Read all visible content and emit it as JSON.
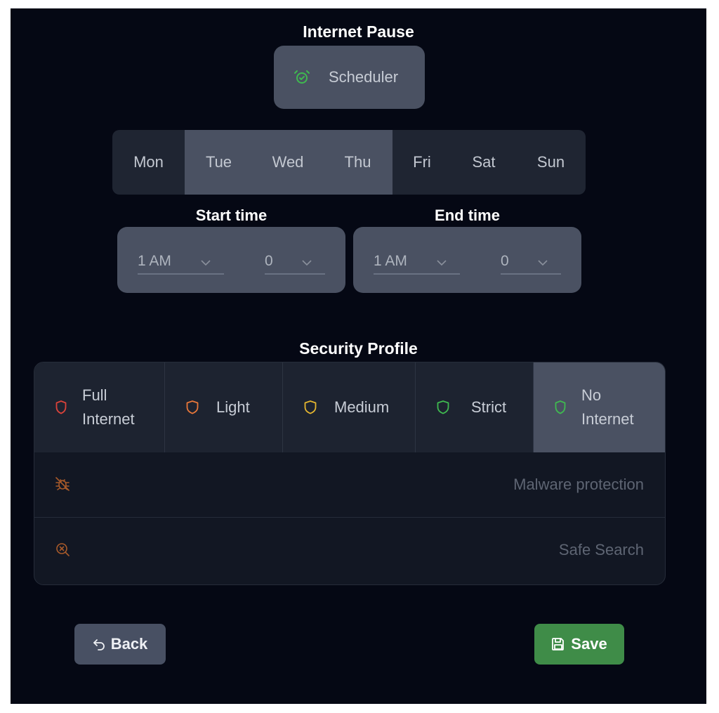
{
  "title": "Internet Pause",
  "scheduler": {
    "label": "Scheduler",
    "icon": "alarm-clock-icon",
    "icon_color": "#3fb950"
  },
  "days": [
    {
      "label": "Mon",
      "selected": false
    },
    {
      "label": "Tue",
      "selected": true
    },
    {
      "label": "Wed",
      "selected": true
    },
    {
      "label": "Thu",
      "selected": true
    },
    {
      "label": "Fri",
      "selected": false
    },
    {
      "label": "Sat",
      "selected": false
    },
    {
      "label": "Sun",
      "selected": false
    }
  ],
  "start_time": {
    "label": "Start time",
    "hour": "1 AM",
    "minute": "0"
  },
  "end_time": {
    "label": "End time",
    "hour": "1 AM",
    "minute": "0"
  },
  "security_profile": {
    "title": "Security Profile",
    "options": [
      {
        "line1": "Full",
        "line2": "Internet",
        "color": "#d9423a",
        "selected": false
      },
      {
        "line1": "Light",
        "line2": "",
        "color": "#e8773a",
        "selected": false
      },
      {
        "line1": "Medium",
        "line2": "",
        "color": "#e4b52f",
        "selected": false
      },
      {
        "line1": "Strict",
        "line2": "",
        "color": "#3fb950",
        "selected": false
      },
      {
        "line1": "No",
        "line2": "Internet",
        "color": "#3fb950",
        "selected": true
      }
    ],
    "features": [
      {
        "label": "Malware protection",
        "icon": "bug-off-icon",
        "color": "#a85a2a"
      },
      {
        "label": "Safe Search",
        "icon": "search-x-icon",
        "color": "#a85a2a"
      }
    ]
  },
  "actions": {
    "back_label": "Back",
    "save_label": "Save"
  }
}
